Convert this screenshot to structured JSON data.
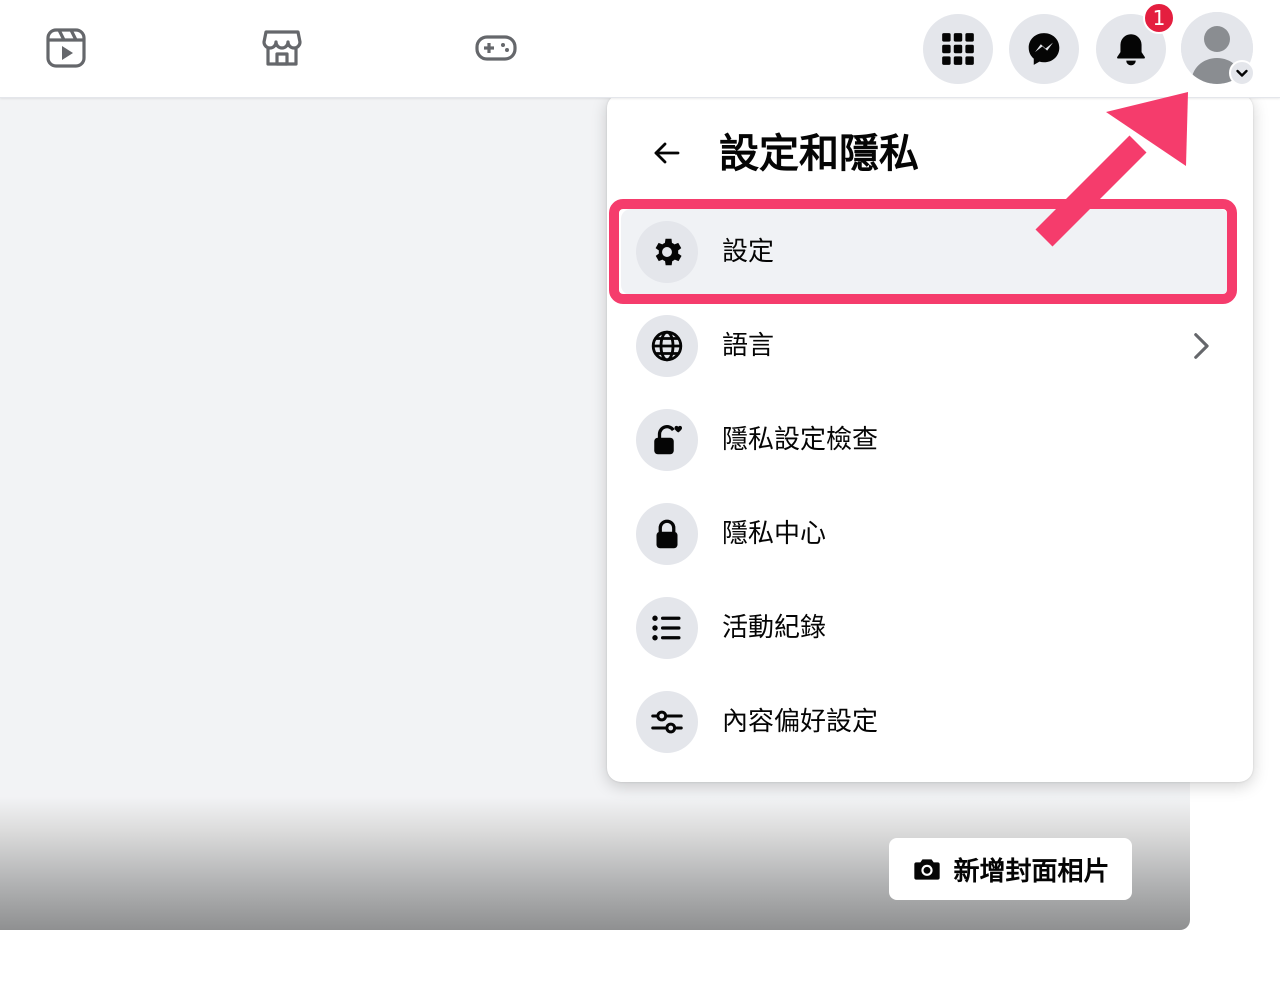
{
  "topbar": {
    "nav_tabs": [
      {
        "name": "reels-icon"
      },
      {
        "name": "marketplace-icon"
      },
      {
        "name": "gaming-icon"
      }
    ],
    "notification_count": "1"
  },
  "menu": {
    "title": "設定和隱私",
    "items": [
      {
        "label": "設定",
        "icon": "gear-icon",
        "highlighted": true
      },
      {
        "label": "語言",
        "icon": "globe-icon",
        "has_submenu": true
      },
      {
        "label": "隱私設定檢查",
        "icon": "lock-heart-icon"
      },
      {
        "label": "隱私中心",
        "icon": "lock-icon"
      },
      {
        "label": "活動紀錄",
        "icon": "list-icon"
      },
      {
        "label": "內容偏好設定",
        "icon": "sliders-icon"
      }
    ]
  },
  "cover": {
    "add_cover_label": "新增封面相片"
  },
  "colors": {
    "annotation": "#f53c6c",
    "badge": "#e41e3f",
    "icon_bg": "#e4e6eb"
  }
}
